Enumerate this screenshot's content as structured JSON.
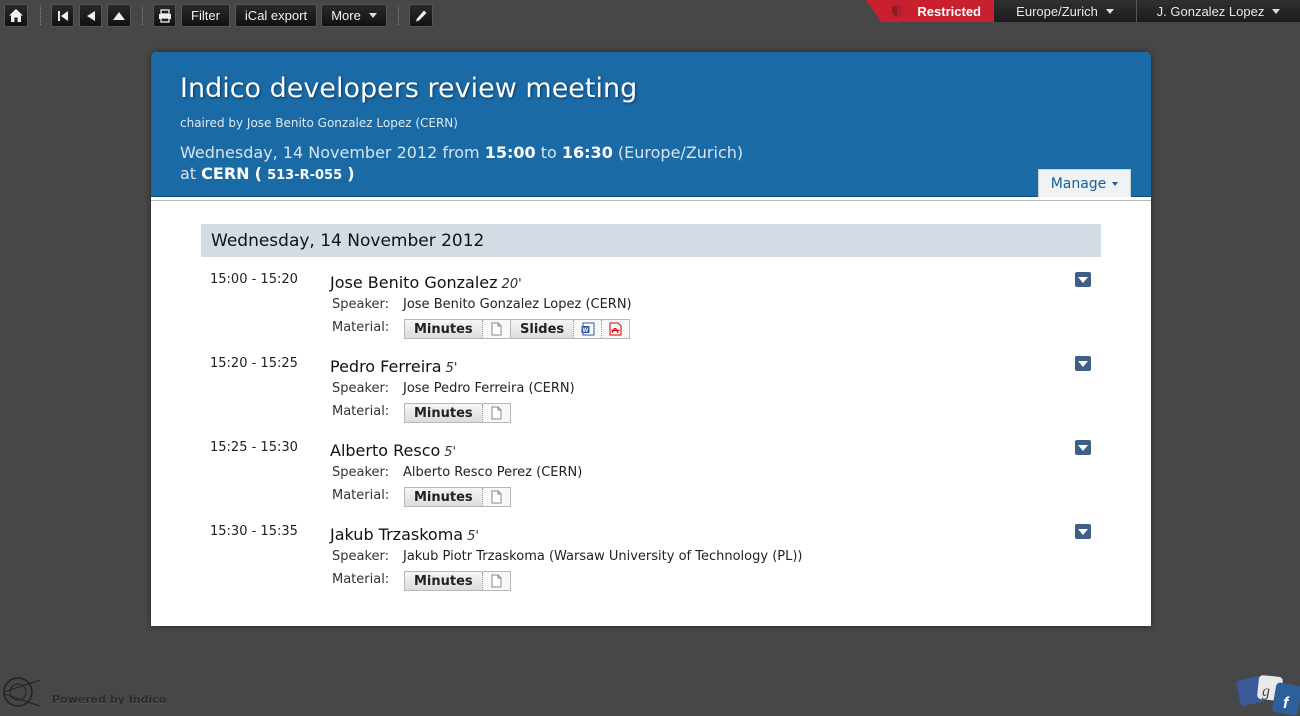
{
  "toolbar": {
    "filter_label": "Filter",
    "ical_label": "iCal export",
    "more_label": "More"
  },
  "session": {
    "restricted_label": "Restricted",
    "timezone": "Europe/Zurich",
    "user": "J. Gonzalez Lopez"
  },
  "event": {
    "title": "Indico developers review meeting",
    "chaired": "chaired by Jose Benito Gonzalez Lopez (CERN)",
    "date_text": "Wednesday, 14 November 2012 from",
    "start": "15:00",
    "to_word": "to",
    "end": "16:30",
    "tz_paren": "(Europe/Zurich)",
    "at_word": "at",
    "location": "CERN",
    "room_open": "(",
    "room": "513-R-055",
    "room_close": ")",
    "manage_label": "Manage"
  },
  "day": {
    "label": "Wednesday, 14 November 2012"
  },
  "labels": {
    "speaker": "Speaker:",
    "material": "Material:"
  },
  "contributions": [
    {
      "time": "15:00 - 15:20",
      "title": "Jose Benito Gonzalez",
      "duration": "20'",
      "speaker": "Jose Benito Gonzalez Lopez (CERN)",
      "materials": [
        {
          "name": "Minutes"
        },
        {
          "name": "Slides"
        }
      ]
    },
    {
      "time": "15:20 - 15:25",
      "title": "Pedro Ferreira",
      "duration": "5'",
      "speaker": "Jose Pedro Ferreira (CERN)",
      "materials": [
        {
          "name": "Minutes"
        }
      ]
    },
    {
      "time": "15:25 - 15:30",
      "title": "Alberto Resco",
      "duration": "5'",
      "speaker": "Alberto Resco Perez (CERN)",
      "materials": [
        {
          "name": "Minutes"
        }
      ]
    },
    {
      "time": "15:30 - 15:35",
      "title": "Jakub Trzaskoma",
      "duration": "5'",
      "speaker": "Jakub Piotr Trzaskoma (Warsaw University of Technology (PL))",
      "materials": [
        {
          "name": "Minutes"
        }
      ]
    }
  ],
  "footer": {
    "powered": "Powered by Indico"
  },
  "colors": {
    "header": "#1a6aa6",
    "restricted": "#c9202f",
    "day_bar": "#d3dce5",
    "background": "#474747"
  }
}
